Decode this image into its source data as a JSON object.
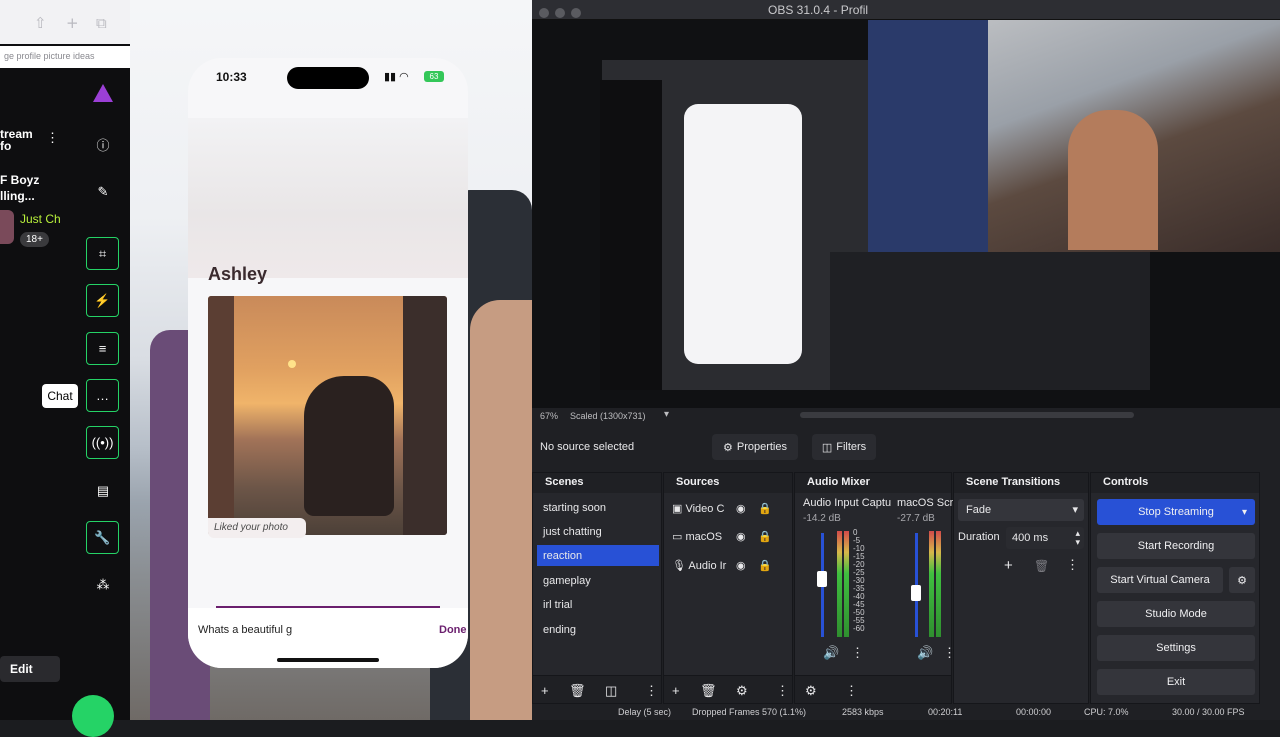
{
  "browser": {
    "url_fragment": "ge profile picture ideas"
  },
  "twitch": {
    "stream_info_title": "tream\nfo",
    "stream_name": "F Boyz\nlling...",
    "category": "Just Ch",
    "rating": "18+",
    "chat_tooltip": "Chat",
    "edit_label": "Edit"
  },
  "phone": {
    "time": "10:33",
    "battery": "63",
    "profile_name": "Ashley",
    "liked_label": "Liked your photo",
    "input_text": "Whats a beautiful g",
    "done_label": "Done"
  },
  "obs": {
    "title": "OBS 31.0.4 - Profil",
    "zoom": "67%",
    "scaled": "Scaled (1300x731)",
    "no_source": "No source selected",
    "properties_label": "Properties",
    "filters_label": "Filters",
    "scenes_title": "Scenes",
    "scenes": [
      "starting soon",
      "just chatting",
      "reaction",
      "gameplay",
      "irl trial",
      "ending"
    ],
    "selected_scene_index": 2,
    "sources_title": "Sources",
    "sources": [
      "Video C",
      "macOS",
      "Audio Ir"
    ],
    "mixer_title": "Audio Mixer",
    "mixer_ch1_name": "Audio Input Captu",
    "mixer_ch1_db": "-14.2 dB",
    "mixer_ch2_name": "macOS Scre",
    "mixer_ch2_db": "-27.7 dB",
    "meter_scale": [
      "0",
      "-5",
      "-10",
      "-15",
      "-20",
      "-25",
      "-30",
      "-35",
      "-40",
      "-45",
      "-50",
      "-55",
      "-60"
    ],
    "transitions_title": "Scene Transitions",
    "transition": "Fade",
    "duration_label": "Duration",
    "duration_value": "400 ms",
    "controls_title": "Controls",
    "controls": [
      "Stop Streaming",
      "Start Recording",
      "Start Virtual Camera",
      "Studio Mode",
      "Settings",
      "Exit"
    ],
    "status_delay": "Delay (5 sec)",
    "status_dropped": "Dropped Frames 570 (1.1%)",
    "status_kbps": "2583 kbps",
    "status_live": "00:20:11",
    "status_rec": "00:00:00",
    "status_cpu": "CPU: 7.0%",
    "status_fps": "30.00 / 30.00 FPS"
  },
  "colors": {
    "accent_green": "#25d366",
    "obs_blue": "#2851d6",
    "phone_purple": "#6b1f6e"
  }
}
